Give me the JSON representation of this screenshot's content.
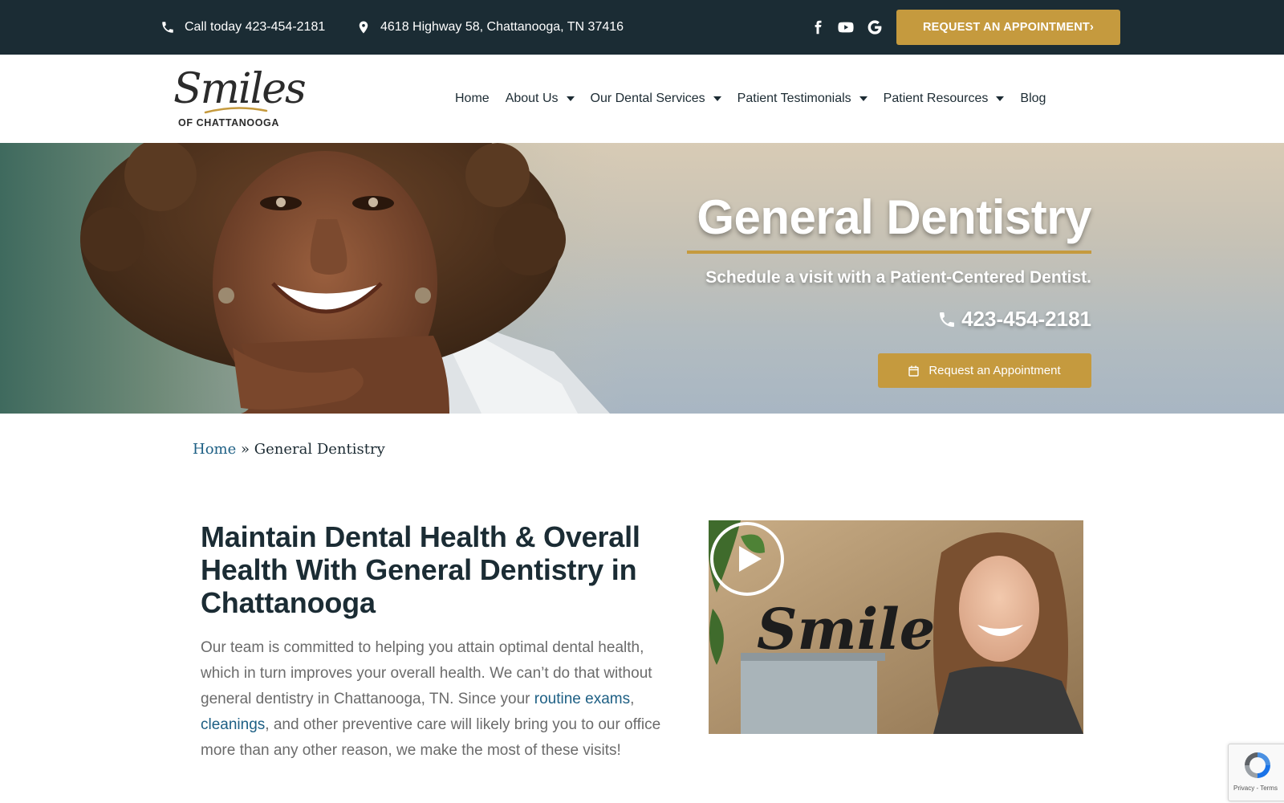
{
  "topbar": {
    "phone_text": "Call today 423-454-2181",
    "address_text": "4618 Highway 58, Chattanooga, TN 37416",
    "social_icons": [
      "facebook-icon",
      "youtube-icon",
      "google-icon"
    ],
    "cta_label": "REQUEST AN APPOINTMENT›"
  },
  "header": {
    "logo_script": "Smiles",
    "logo_sub": "OF CHATTANOOGA",
    "nav": [
      {
        "label": "Home",
        "has_dropdown": false
      },
      {
        "label": "About Us",
        "has_dropdown": true
      },
      {
        "label": "Our Dental Services",
        "has_dropdown": true
      },
      {
        "label": "Patient Testimonials",
        "has_dropdown": true
      },
      {
        "label": "Patient Resources",
        "has_dropdown": true
      },
      {
        "label": "Blog",
        "has_dropdown": false
      }
    ]
  },
  "hero": {
    "title": "General Dentistry",
    "subtitle": "Schedule a visit with a Patient-Centered Dentist.",
    "phone": "423-454-2181",
    "button_label": "Request an Appointment"
  },
  "breadcrumb": {
    "home": "Home",
    "separator": " » ",
    "current": "General Dentistry"
  },
  "content": {
    "title": "Maintain Dental Health & Overall Health With General Dentistry in Chattanooga",
    "body_part1": "Our team is committed to helping you attain optimal dental health, which in turn improves your overall health. We can’t do that without general dentistry in Chattanooga, TN. Since your ",
    "link1": "routine exams",
    "comma": ", ",
    "link2": "cleanings",
    "body_part2": ", and other preventive care will likely bring you to our office more than any other reason, we make the most of these visits!",
    "video_sign_text": "Smile"
  },
  "recaptcha": {
    "footer": "Privacy - Terms"
  },
  "colors": {
    "topbar_bg": "#1b2c34",
    "accent_gold": "#c59a3e",
    "link_blue": "#1d5f84",
    "heading_dark": "#1b2c34",
    "body_gray": "#6b6b6b"
  }
}
